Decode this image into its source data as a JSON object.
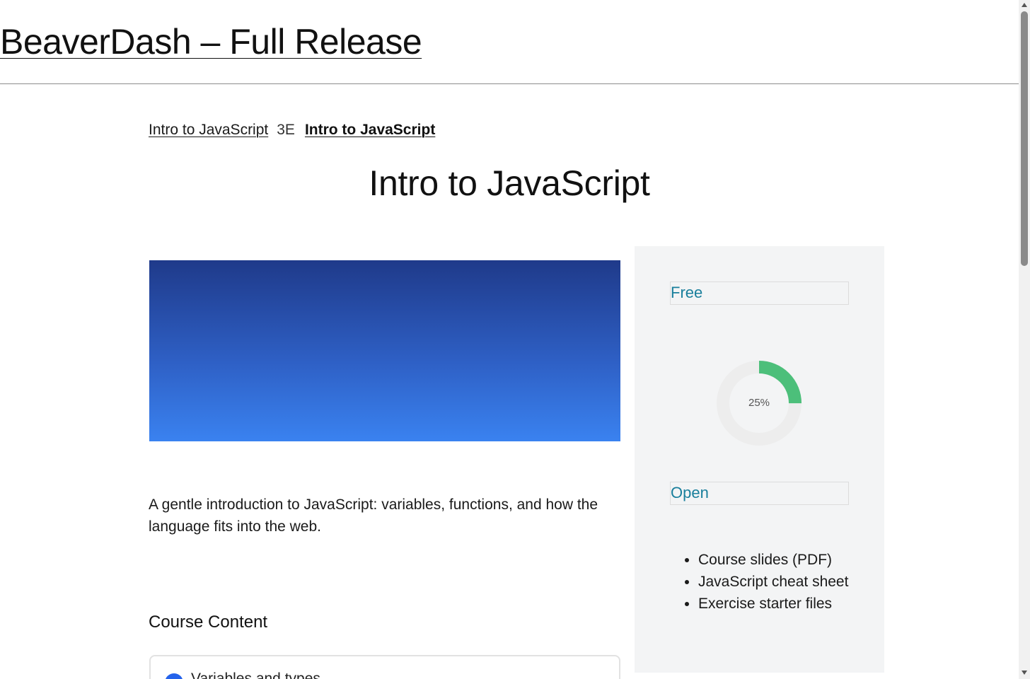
{
  "header": {
    "site_title": "BeaverDash – Full Release"
  },
  "breadcrumb": {
    "parent_label": "Intro to JavaScript",
    "separator": "3E",
    "current_label": "Intro to JavaScript"
  },
  "page": {
    "title": "Intro to JavaScript",
    "description": "A gentle introduction to JavaScript: variables, functions, and how the language fits into the web."
  },
  "content": {
    "heading": "Course Content",
    "lessons": [
      {
        "title": "Variables and types"
      }
    ]
  },
  "sidebar": {
    "price": "Free",
    "progress": {
      "percent": 25,
      "label": "25%"
    },
    "status": "Open",
    "materials": [
      "Course slides (PDF)",
      "JavaScript cheat sheet",
      "Exercise starter files"
    ]
  },
  "colors": {
    "progress_fill": "#4cbf7a",
    "progress_track": "#ededed",
    "accent_text": "#1a7f9c",
    "hero_top": "#1f3a8a",
    "hero_bottom": "#3a82f0",
    "lesson_dot": "#2563eb"
  }
}
